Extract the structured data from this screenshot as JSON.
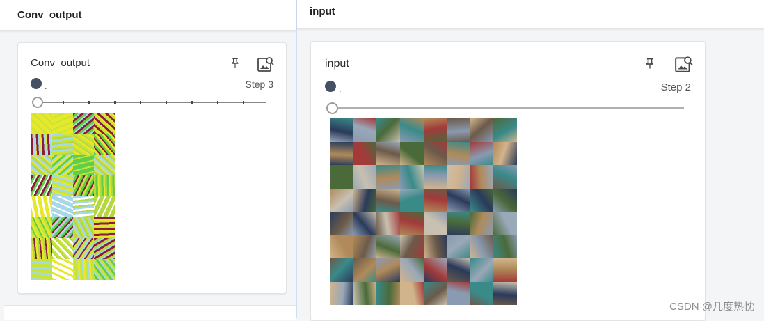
{
  "left_pane": {
    "header_title": "Conv_output",
    "card": {
      "title": "Conv_output",
      "pin_icon": "pin-icon",
      "image_search_icon": "image-search-icon",
      "run_label": ".",
      "step_label": "Step 3",
      "slider_value": 0
    }
  },
  "right_pane": {
    "header_title": "input",
    "card": {
      "title": "input",
      "pin_icon": "pin-icon",
      "image_search_icon": "image-search-icon",
      "run_label": ".",
      "step_label": "Step 2",
      "slider_value": 0
    }
  },
  "colors": {
    "run_dot": "#455063",
    "divider": "#cfe0f6",
    "conv_palette": [
      "#c8e33a",
      "#a7d8e8",
      "#5fcf4a",
      "#e6e82a",
      "#8e1b3a",
      "#ffffff",
      "#b5d742"
    ],
    "input_palette": [
      "#6b5a4a",
      "#8a9ab0",
      "#a33a3a",
      "#4a6a3a",
      "#c8c0b0",
      "#2a3a5a",
      "#b08a5a",
      "#3a8a8a",
      "#9aa8b8",
      "#d2b48c"
    ]
  },
  "watermark": "CSDN @几度热忱"
}
